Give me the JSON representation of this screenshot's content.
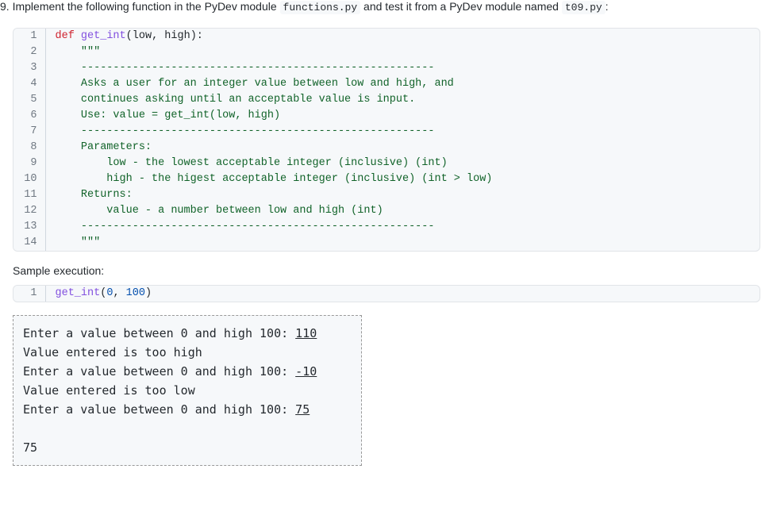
{
  "question": {
    "number": "9.",
    "text_before_code1": "Implement the following function in the PyDev module ",
    "code1": "functions.py",
    "text_between": " and test it from a PyDev module named ",
    "code2": "t09.py",
    "text_after": ":"
  },
  "code_block1": {
    "lines": [
      {
        "n": "1",
        "html": "<span class=\"kw\">def</span> <span class=\"fn\">get_int</span><span class=\"paren\">(</span><span class=\"param\">low</span><span class=\"comma\">,</span> <span class=\"param\">high</span><span class=\"paren\">)</span><span class=\"comma\">:</span>"
      },
      {
        "n": "2",
        "html": "    <span class=\"docstring\">\"\"\"</span>"
      },
      {
        "n": "3",
        "html": "    <span class=\"docstring\">-------------------------------------------------------</span>"
      },
      {
        "n": "4",
        "html": "    <span class=\"docstring\">Asks a user for an integer value between low and high, and</span>"
      },
      {
        "n": "5",
        "html": "    <span class=\"docstring\">continues asking until an acceptable value is input.</span>"
      },
      {
        "n": "6",
        "html": "    <span class=\"docstring\">Use: value = get_int(low, high)</span>"
      },
      {
        "n": "7",
        "html": "    <span class=\"docstring\">-------------------------------------------------------</span>"
      },
      {
        "n": "8",
        "html": "    <span class=\"docstring\">Parameters:</span>"
      },
      {
        "n": "9",
        "html": "    <span class=\"docstring\">    low - the lowest acceptable integer (inclusive) (int)</span>"
      },
      {
        "n": "10",
        "html": "    <span class=\"docstring\">    high - the higest acceptable integer (inclusive) (int > low)</span>"
      },
      {
        "n": "11",
        "html": "    <span class=\"docstring\">Returns:</span>"
      },
      {
        "n": "12",
        "html": "    <span class=\"docstring\">    value - a number between low and high (int)</span>"
      },
      {
        "n": "13",
        "html": "    <span class=\"docstring\">-------------------------------------------------------</span>"
      },
      {
        "n": "14",
        "html": "    <span class=\"docstring\">\"\"\"</span>"
      }
    ]
  },
  "sample_label": "Sample execution:",
  "code_block2": {
    "lines": [
      {
        "n": "1",
        "html": "<span class=\"fn\">get_int</span><span class=\"paren\">(</span><span class=\"num\">0</span><span class=\"comma\">,</span> <span class=\"num\">100</span><span class=\"paren\">)</span>"
      }
    ]
  },
  "output": {
    "lines": [
      {
        "prompt": "Enter a value between 0 and high 100: ",
        "input": "110"
      },
      {
        "prompt": "Value entered is too high",
        "input": ""
      },
      {
        "prompt": "Enter a value between 0 and high 100: ",
        "input": "-10"
      },
      {
        "prompt": "Value entered is too low",
        "input": ""
      },
      {
        "prompt": "Enter a value between 0 and high 100: ",
        "input": "75"
      },
      {
        "prompt": "",
        "input": ""
      },
      {
        "prompt": "75",
        "input": ""
      }
    ]
  }
}
